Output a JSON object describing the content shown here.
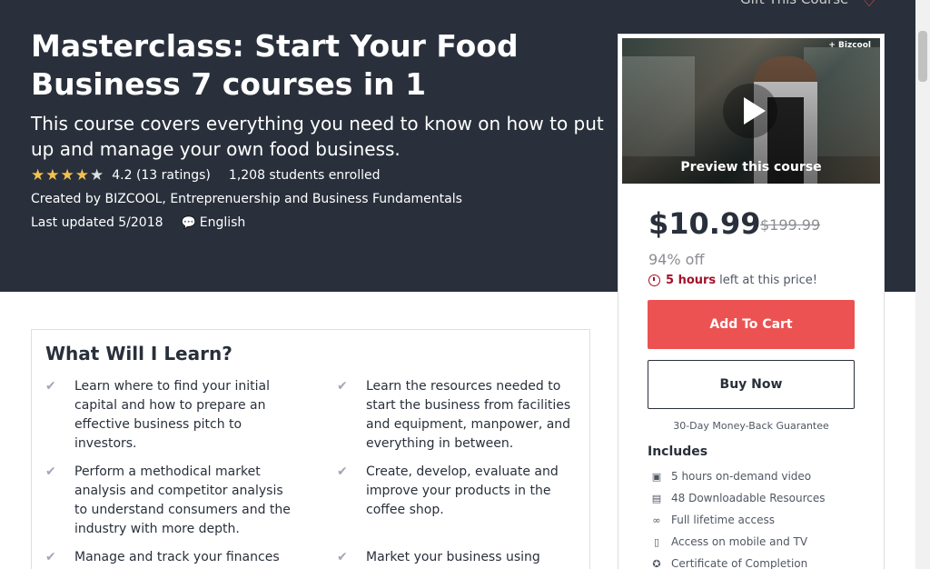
{
  "header": {
    "gift_label": "Gift This Course",
    "title": "Masterclass: Start Your Food Business 7 courses in 1",
    "subtitle": "This course covers everything you need to know on how to put up and manage your own food business.",
    "rating_value": "4.2",
    "rating_count": "(13 ratings)",
    "rating_fraction": 0.84,
    "enrolled": "1,208 students enrolled",
    "created_by": "Created by BIZCOOL, Entreprenuership and Business Fundamentals",
    "last_updated": "Last updated 5/2018",
    "language": "English"
  },
  "sidebar": {
    "preview_logo": "+ Bizcool",
    "preview_label": "Preview this course",
    "price": "$10.99",
    "original_price": "$199.99",
    "discount": "94% off",
    "timer_bold": "5 hours",
    "timer_rest": "left at this price!",
    "add_to_cart": "Add To Cart",
    "buy_now": "Buy Now",
    "guarantee": "30-Day Money-Back Guarantee",
    "includes_title": "Includes",
    "includes": [
      {
        "icon": "video-icon",
        "label": "5 hours on-demand video"
      },
      {
        "icon": "file-icon",
        "label": "48 Downloadable Resources"
      },
      {
        "icon": "infinity-icon",
        "label": "Full lifetime access"
      },
      {
        "icon": "mobile-icon",
        "label": "Access on mobile and TV"
      },
      {
        "icon": "certificate-icon",
        "label": "Certificate of Completion"
      }
    ]
  },
  "learn": {
    "title": "What Will I Learn?",
    "items": [
      "Learn where to find your initial capital and how to prepare an effective business pitch to investors.",
      "Learn the resources needed to start the business from facilities and equipment, manpower, and everything in between.",
      "Perform a methodical market analysis and competitor analysis to understand consumers and the industry with more depth.",
      "Create, develop, evaluate and improve your products in the coffee shop.",
      "Manage and track your finances",
      "Market your business using"
    ]
  },
  "colors": {
    "hero_bg": "#29303b",
    "accent": "#ec5252",
    "star": "#f4c150",
    "timer": "#a2112a"
  }
}
